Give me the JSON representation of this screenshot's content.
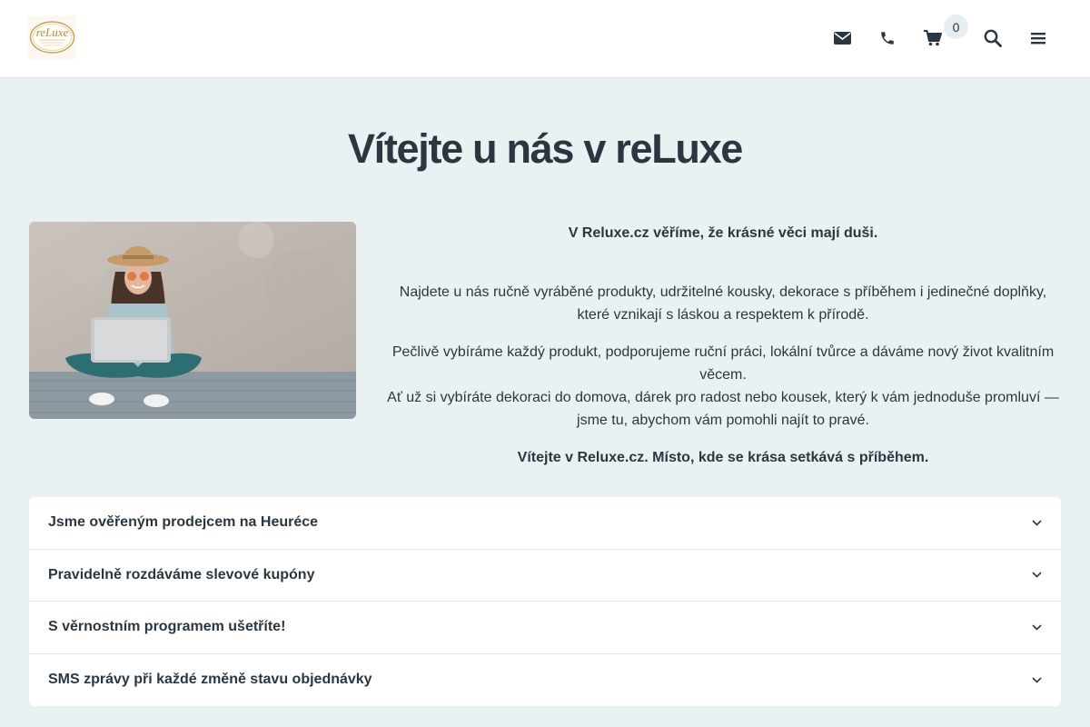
{
  "header": {
    "logo_icon": "reluxe-logo-icon",
    "icons": [
      "envelope-icon",
      "phone-icon",
      "cart-icon",
      "search-icon",
      "menu-icon"
    ],
    "cart_count": "0"
  },
  "hero": {
    "title": "Vítejte u nás v reLuxe",
    "image": "woman-with-laptop-photo"
  },
  "intro": {
    "lead": "V Reluxe.cz věříme, že krásné věci mají duši.",
    "paragraph1": "Najdete u nás ručně vyráběné produkty, udržitelné kousky, dekorace s příběhem i jedinečné doplňky, které vznikají s láskou a respektem k přírodě.",
    "paragraph2_line1": "Pečlivě vybíráme každý produkt, podporujeme ruční práci, lokální tvůrce a dáváme nový život kvalitním věcem.",
    "paragraph2_line2": "Ať už si vybíráte dekoraci do domova, dárek pro radost nebo kousek, který k vám jednoduše promluví — jsme tu, abychom vám pomohli najít to pravé.",
    "closing": "Vítejte v Reluxe.cz. Místo, kde se krása setkává s příběhem."
  },
  "accordion": {
    "items": [
      {
        "label": "Jsme ověřeným prodejcem na Heuréce"
      },
      {
        "label": "Pravidelně rozdáváme slevové kupóny"
      },
      {
        "label": "S věrnostním programem ušetříte!"
      },
      {
        "label": "SMS zprávy při každé změně stavu objednávky"
      }
    ]
  },
  "colors": {
    "page_bg": "#eaf1f3",
    "text": "#2b3740",
    "logo_gold": "#c9a35a"
  }
}
